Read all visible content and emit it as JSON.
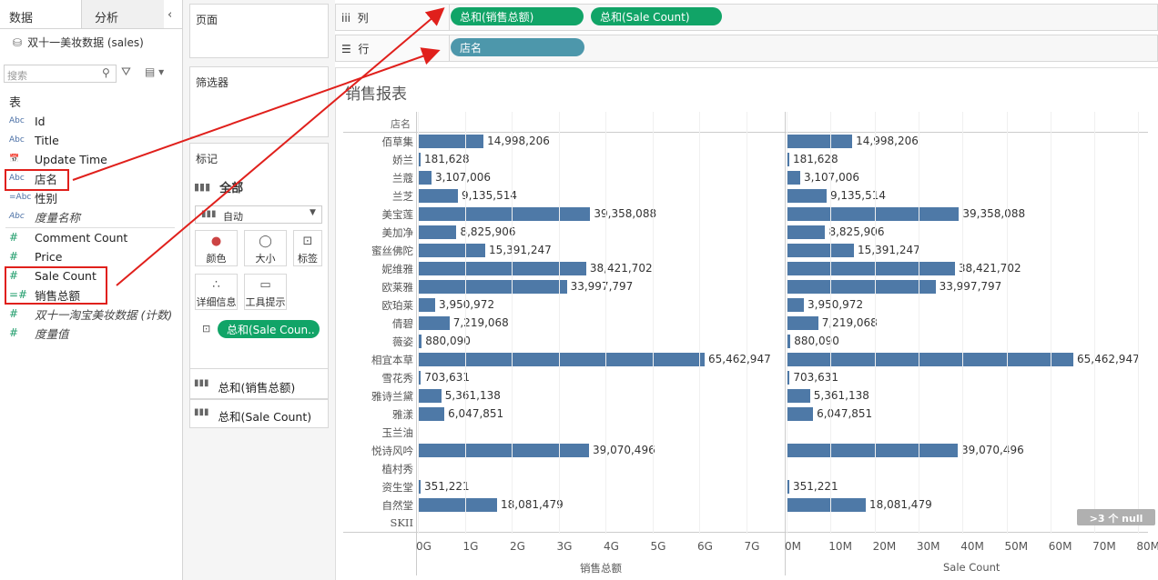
{
  "tabs": {
    "data": "数据",
    "analysis": "分析"
  },
  "datasource": "双十一美妆数据 (sales)",
  "search_placeholder": "搜索",
  "section_table": "表",
  "fields": [
    {
      "icon": "Abc",
      "label": "Id"
    },
    {
      "icon": "Abc",
      "label": "Title"
    },
    {
      "icon": "calendar",
      "label": "Update Time"
    },
    {
      "icon": "Abc",
      "label": "店名"
    },
    {
      "icon": "=Abc",
      "label": "性别"
    },
    {
      "icon": "Abc",
      "label": "度量名称"
    }
  ],
  "measures": [
    {
      "icon": "#",
      "label": "Comment Count"
    },
    {
      "icon": "#",
      "label": "Price"
    },
    {
      "icon": "#",
      "label": "Sale Count"
    },
    {
      "icon": "=#",
      "label": "销售总额"
    },
    {
      "icon": "#",
      "label": "双十一淘宝美妆数据 (计数)"
    },
    {
      "icon": "#",
      "label": "度量值"
    }
  ],
  "cards": {
    "pages": "页面",
    "filters": "筛选器",
    "marks": "标记"
  },
  "marks": {
    "all": "全部",
    "type": "自动",
    "buttons": [
      "颜色",
      "大小",
      "标签",
      "详细信息",
      "工具提示"
    ],
    "label_pill": "总和(Sale Coun..",
    "shelf_items": [
      "总和(销售总额)",
      "总和(Sale Count)"
    ]
  },
  "shelves": {
    "columns_label": "列",
    "rows_label": "行",
    "columns_pills": [
      "总和(销售总额)",
      "总和(Sale Count)"
    ],
    "rows_pills": [
      "店名"
    ]
  },
  "viz_title": "销售报表",
  "row_header": "店名",
  "null_badge": ">3 个 null",
  "chart_data": {
    "type": "bar",
    "title": "销售报表",
    "categories": [
      "佰草集",
      "娇兰",
      "兰蔻",
      "兰芝",
      "美宝莲",
      "美加净",
      "蜜丝佛陀",
      "妮维雅",
      "欧莱雅",
      "欧珀莱",
      "倩碧",
      "薇姿",
      "相宜本草",
      "雪花秀",
      "雅诗兰黛",
      "雅漾",
      "玉兰油",
      "悦诗风吟",
      "植村秀",
      "资生堂",
      "自然堂",
      "SKII"
    ],
    "series": [
      {
        "name": "销售总额",
        "values": [
          14998206,
          181628,
          3107006,
          9135514,
          39358088,
          8825906,
          15391247,
          38421702,
          33997797,
          3950972,
          7219068,
          880090,
          65462947,
          703631,
          5361138,
          6047851,
          null,
          39070496,
          null,
          351221,
          18081479,
          null
        ]
      },
      {
        "name": "Sale Count",
        "values": [
          14998206,
          181628,
          3107006,
          9135514,
          39358088,
          8825906,
          15391247,
          38421702,
          33997797,
          3950972,
          7219068,
          880090,
          65462947,
          703631,
          5361138,
          6047851,
          null,
          39070496,
          null,
          351221,
          18081479,
          null
        ]
      }
    ],
    "labels": [
      "14,998,206",
      "181,628",
      "3,107,006",
      "9,135,514",
      "39,358,088",
      "8,825,906",
      "15,391,247",
      "38,421,702",
      "33,997,797",
      "3,950,972",
      "7,219,068",
      "880,090",
      "65,462,947",
      "703,631",
      "5,361,138",
      "6,047,851",
      "",
      "39,070,496",
      "",
      "351,221",
      "18,081,479",
      ""
    ],
    "axes": [
      {
        "xlabel": "销售总额",
        "ticks": [
          "0G",
          "1G",
          "2G",
          "3G",
          "4G",
          "5G",
          "6G",
          "7G"
        ],
        "xlim": [
          0,
          7800000000
        ]
      },
      {
        "xlabel": "Sale Count",
        "ticks": [
          "0M",
          "10M",
          "20M",
          "30M",
          "40M",
          "50M",
          "60M",
          "70M",
          "80M"
        ],
        "xlim": [
          0,
          82000000
        ]
      }
    ],
    "bar_scale_note": "bars drawn proportional to label values"
  },
  "colors": {
    "bar": "#4e79a7",
    "pill_green": "#11a467",
    "pill_blue": "#4d97ab",
    "highlight": "#e0201c"
  }
}
